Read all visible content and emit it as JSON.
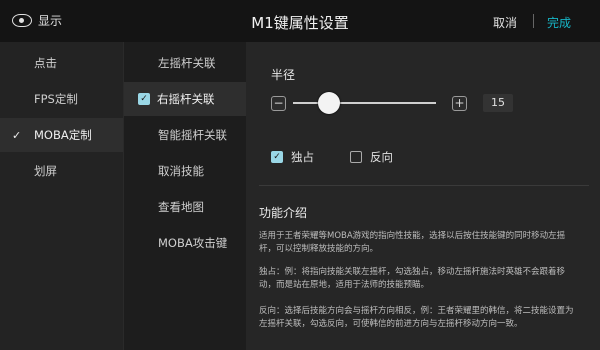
{
  "header": {
    "show_label": "显示",
    "title": "M1键属性设置",
    "cancel_label": "取消",
    "separator": "|",
    "done_label": "完成",
    "accent_color": "#17b6c7"
  },
  "left_menu": {
    "selected_index": 2,
    "items": [
      {
        "label": "点击"
      },
      {
        "label": "FPS定制"
      },
      {
        "label": "MOBA定制"
      },
      {
        "label": "划屏"
      }
    ]
  },
  "sub_menu": {
    "selected_index": 1,
    "items": [
      {
        "label": "左摇杆关联"
      },
      {
        "label": "右摇杆关联"
      },
      {
        "label": "智能摇杆关联"
      },
      {
        "label": "取消技能"
      },
      {
        "label": "查看地图"
      },
      {
        "label": "MOBA攻击键"
      }
    ]
  },
  "radius": {
    "label": "半径",
    "minus": "−",
    "plus": "+",
    "value": "15",
    "slider_fraction": 0.25
  },
  "options": {
    "exclusive_label": "独占",
    "exclusive_checked": true,
    "reverse_label": "反向",
    "reverse_checked": false
  },
  "intro": {
    "title": "功能介绍",
    "para1": "适用于王者荣耀等MOBA游戏的指向性技能，选择以后按住技能键的同时移动左摇杆，可以控制释放技能的方向。",
    "para2": "独占：例：将指向技能关联左摇杆，勾选独占，移动左摇杆施法时英雄不会跟着移动，而是站在原地，适用于法师的技能预瞄。",
    "para3": "反向：选择后技能方向会与摇杆方向相反，例：王者荣耀里的韩信，将二技能设置为左摇杆关联，勾选反向，可使韩信的前进方向与左摇杆移动方向一致。"
  }
}
